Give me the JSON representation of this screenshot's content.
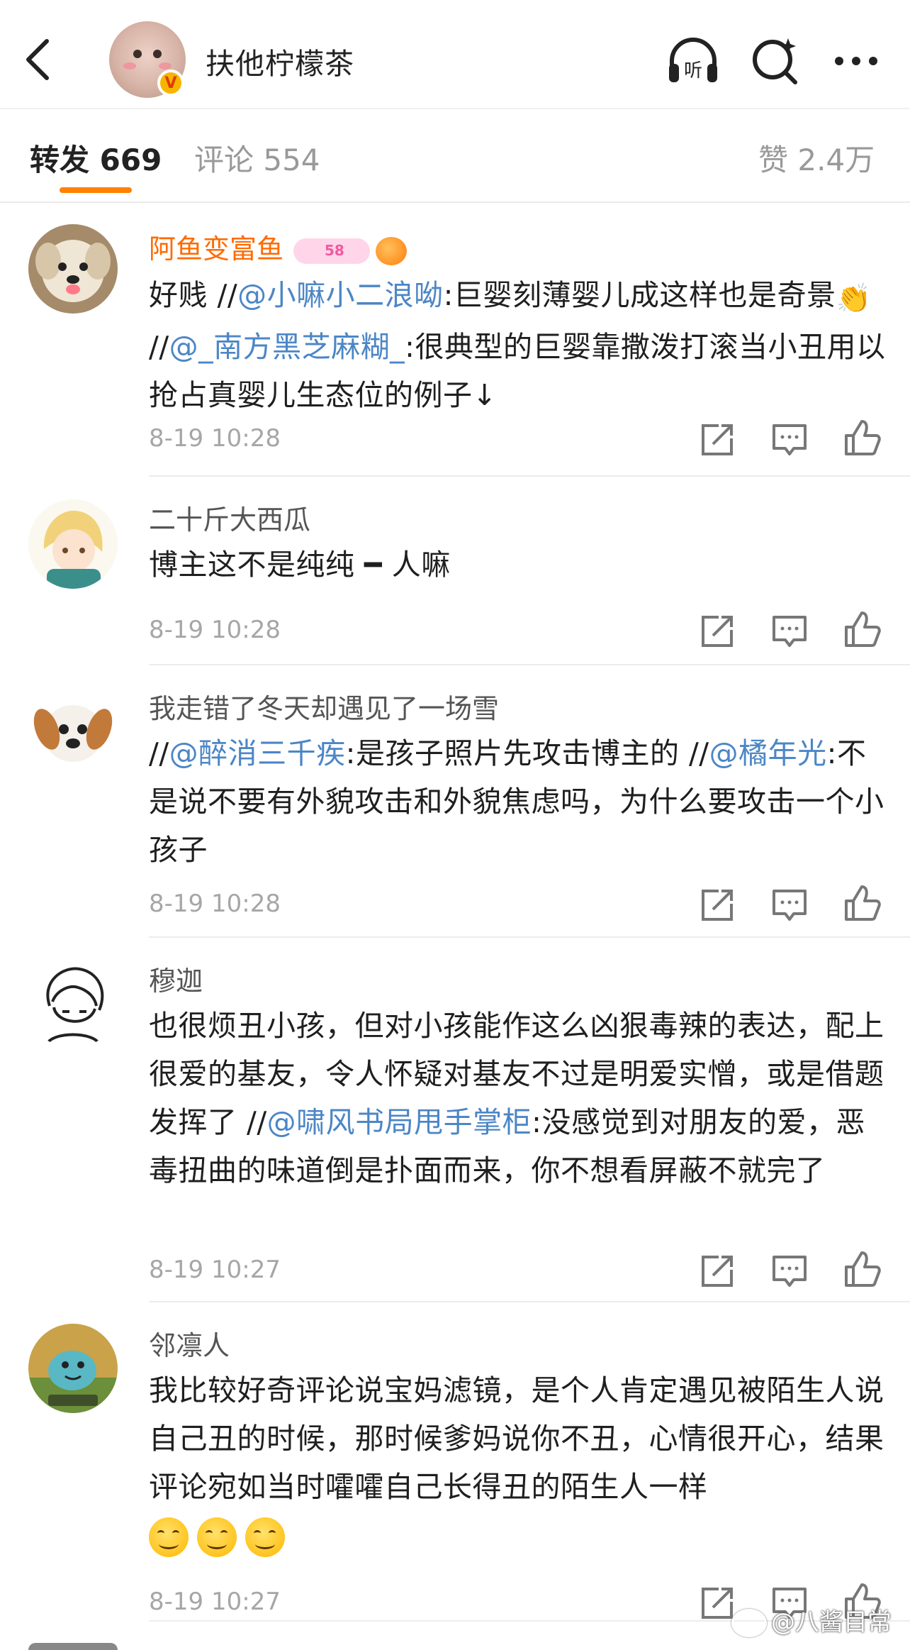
{
  "header": {
    "title": "扶他柠檬茶",
    "verified_mark": "V",
    "listen_label": "听"
  },
  "tabs": {
    "repost": "转发 669",
    "comment": "评论 554",
    "like": "赞 2.4万"
  },
  "comments": [
    {
      "name": "阿鱼变富鱼",
      "badge_text": "58",
      "body_1": "好贱 //",
      "mention_1": "@小嘛小二浪呦",
      "body_2": ":巨婴刻薄婴儿成这样也是奇景",
      "clap": "👏",
      "body_3": "//",
      "mention_2": "@_南方黑芝麻糊_",
      "body_4": ":很典型的巨婴靠撒泼打滚当小丑用以抢占真婴儿生态位的例子↓",
      "time": "8-19 10:28"
    },
    {
      "name": "二十斤大西瓜",
      "body_1": "博主这不是纯纯 ━ 人嘛",
      "time": "8-19 10:28"
    },
    {
      "name": "我走错了冬天却遇见了一场雪",
      "body_1": "//",
      "mention_1": "@醉消三千疾",
      "body_2": ":是孩子照片先攻击博主的 //",
      "mention_2": "@橘年光",
      "body_3": ":不是说不要有外貌攻击和外貌焦虑吗，为什么要攻击一个小孩子",
      "time": "8-19 10:28"
    },
    {
      "name": "穆迦",
      "body_1": "也很烦丑小孩，但对小孩能作这么凶狠毒辣的表达，配上很爱的基友，令人怀疑对基友不过是明爱实憎，或是借题发挥了 //",
      "mention_1": "@啸风书局甩手掌柜",
      "body_2": ":没感觉到对朋友的爱，恶毒扭曲的味道倒是扑面而来，你不想看屏蔽不就完了",
      "time": "8-19 10:27"
    },
    {
      "name": "邻凛人",
      "body_1": "我比较好奇评论说宝妈滤镜，是个人肯定遇见被陌生人说自己丑的时候，那时候爹妈说你不丑，心情很开心，结果评论宛如当时嚯嚯自己长得丑的陌生人一样",
      "time": "8-19 10:27"
    }
  ],
  "watermark": "@八酱目常",
  "colors": {
    "accent": "#ff8200",
    "mention": "#4c86c6",
    "vip_name": "#ff6a00"
  }
}
